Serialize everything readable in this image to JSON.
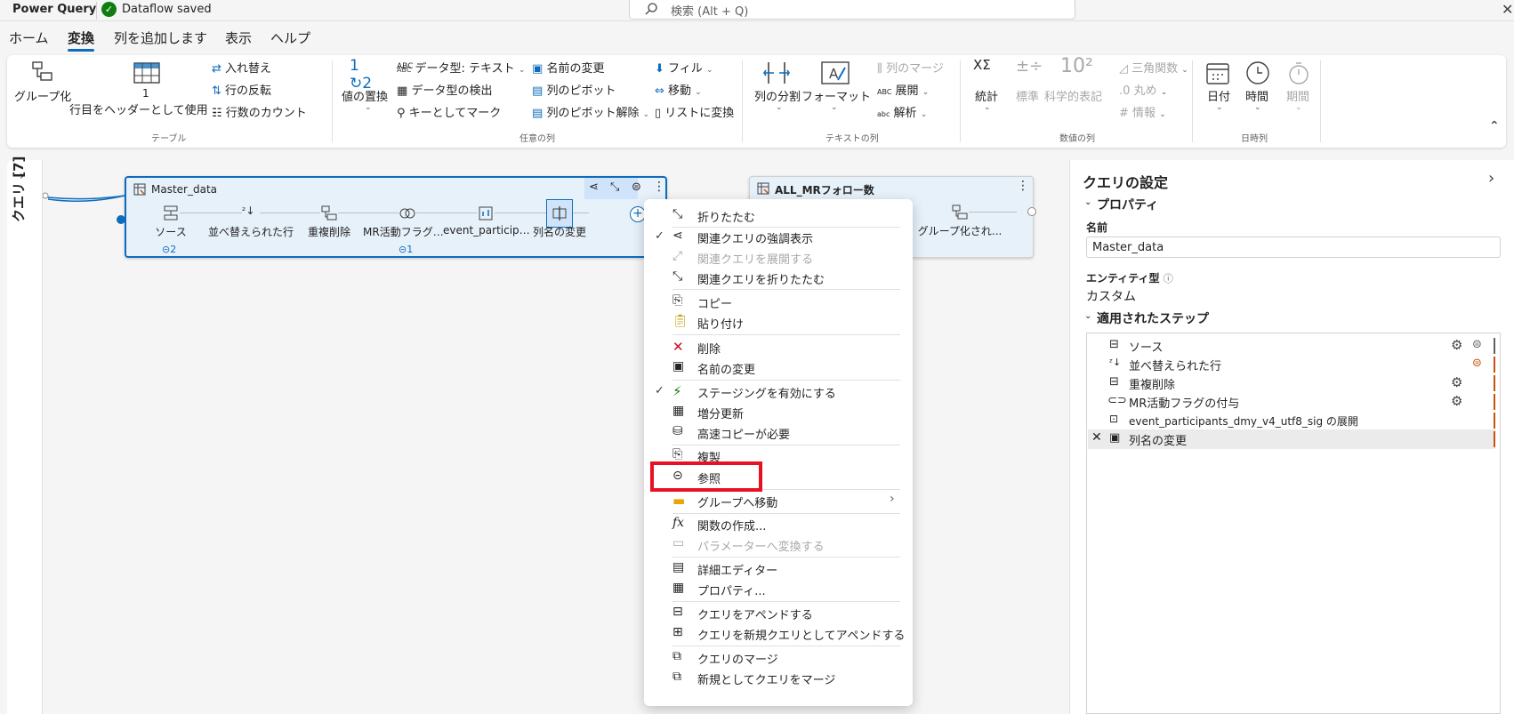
{
  "titlebar": {
    "app_title": "Power Query",
    "saved_text": "Dataflow saved",
    "search_placeholder": "検索 (Alt + Q)"
  },
  "tabs": [
    "ホーム",
    "変換",
    "列を追加します",
    "表示",
    "ヘルプ"
  ],
  "active_tab": "変換",
  "ribbon": {
    "table_group": {
      "label": "テーブル",
      "group_by": "グループ化",
      "use_first_row": "1\n行目をヘッダーとして使用",
      "transpose": "入れ替え",
      "reverse_rows": "行の反転",
      "count_rows": "行数のカウント"
    },
    "any_column_group": {
      "label": "任意の列",
      "replace_values": "値の置換",
      "data_type": "データ型: テキスト",
      "detect_type": "データ型の検出",
      "mark_key": "キーとしてマーク",
      "rename": "名前の変更",
      "pivot": "列のピボット",
      "unpivot": "列のピボット解除",
      "fill": "フィル",
      "move": "移動",
      "to_list": "リストに変換"
    },
    "text_group": {
      "label": "テキストの列",
      "split": "列の分割",
      "format": "フォーマット",
      "merge_cols": "列のマージ",
      "expand": "展開",
      "parse": "解析"
    },
    "number_group": {
      "label": "数値の列",
      "stats": "統計",
      "standard": "標準",
      "scientific": "科学的表記",
      "trig": "三角関数",
      "round": "丸め",
      "info": "情報"
    },
    "datetime_group": {
      "label": "日時列",
      "date": "日付",
      "time": "時間",
      "duration": "期間"
    }
  },
  "left_pane": {
    "label": "クエリ [7]"
  },
  "canvas": {
    "card1": {
      "title": "Master_data",
      "steps": [
        "ソース",
        "並べ替えられた行",
        "重複削除",
        "MR活動フラグの...",
        "event_participant...",
        "列名の変更"
      ],
      "source_links": "2",
      "flag_links": "1"
    },
    "card2": {
      "title": "ALL_MRフォロー数",
      "last_step": "グループ化され..."
    }
  },
  "context_menu": {
    "items": {
      "collapse": "折りたたむ",
      "highlight_related": "関連クエリの強調表示",
      "expand_related": "関連クエリを展開する",
      "collapse_related": "関連クエリを折りたたむ",
      "copy": "コピー",
      "paste": "貼り付け",
      "delete": "削除",
      "rename": "名前の変更",
      "staging": "ステージングを有効にする",
      "incremental": "増分更新",
      "fast_copy": "高速コピーが必要",
      "duplicate": "複製",
      "reference": "参照",
      "move_group": "グループへ移動",
      "create_function": "関数の作成...",
      "convert_param": "パラメーターへ変換する",
      "advanced_editor": "詳細エディター",
      "properties": "プロパティ...",
      "append": "クエリをアペンドする",
      "append_new": "クエリを新規クエリとしてアペンドする",
      "merge": "クエリのマージ",
      "merge_new": "新規としてクエリをマージ"
    }
  },
  "right_pane": {
    "title": "クエリの設定",
    "properties_header": "プロパティ",
    "name_label": "名前",
    "name_value": "Master_data",
    "entity_label": "エンティティ型",
    "entity_value": "カスタム",
    "steps_header": "適用されたステップ",
    "steps": [
      "ソース",
      "並べ替えられた行",
      "重複削除",
      "MR活動フラグの付与",
      "event_participants_dmy_v4_utf8_sig の展開",
      "列名の変更"
    ]
  },
  "colors": {
    "accent": "#0f6cbd",
    "highlight_box": "#e81123",
    "step_bar": "#ca5010",
    "saved": "#107c10"
  }
}
